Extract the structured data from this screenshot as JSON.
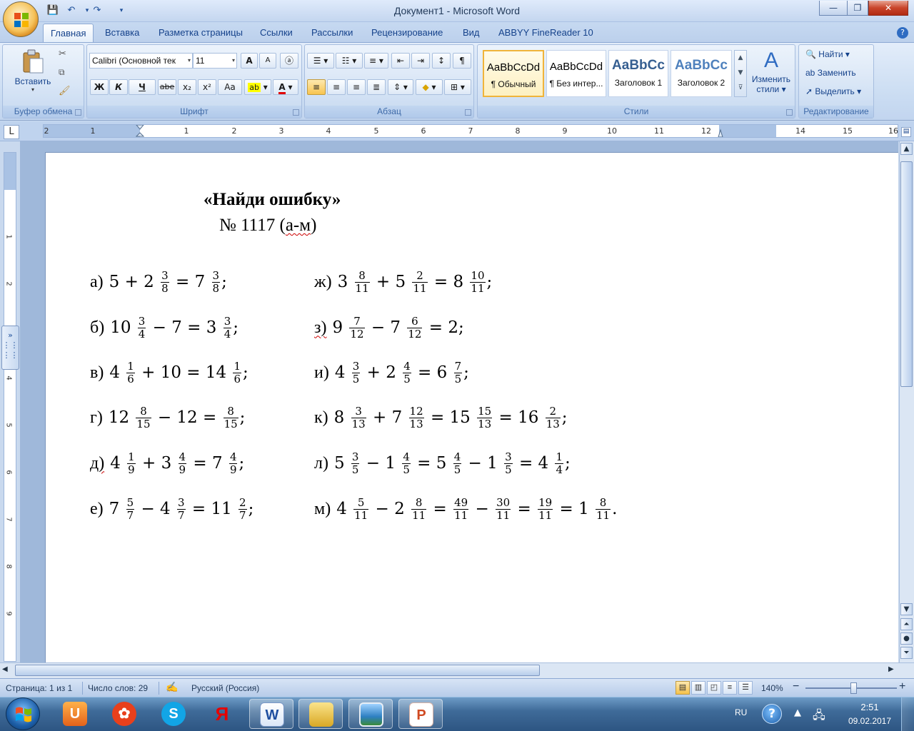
{
  "window": {
    "title": "Документ1 - Microsoft Word",
    "minimize": "—",
    "maximize": "❐",
    "close": "✕"
  },
  "qat": {
    "save": "💾",
    "undo": "↶",
    "redo": "↷",
    "customize": "▾"
  },
  "tabs": [
    "Главная",
    "Вставка",
    "Разметка страницы",
    "Ссылки",
    "Рассылки",
    "Рецензирование",
    "Вид",
    "ABBYY FineReader 10"
  ],
  "ribbon": {
    "clipboard": {
      "label": "Буфер обмена",
      "paste": "Вставить"
    },
    "font": {
      "label": "Шрифт",
      "font_name": "Calibri (Основной тек",
      "font_size": "11",
      "grow": "A",
      "shrink": "A",
      "clear": "ⓐ",
      "bold": "Ж",
      "italic": "К",
      "underline": "Ч",
      "strike": "abe",
      "subscript": "x₂",
      "superscript": "x²",
      "case": "Aa",
      "highlight": "ab",
      "font_color": "A"
    },
    "paragraph": {
      "label": "Абзац",
      "pilcrow": "¶"
    },
    "styles": {
      "label": "Стили",
      "items": [
        {
          "sample": "AaBbCcDd",
          "name": "¶ Обычный"
        },
        {
          "sample": "AaBbCcDd",
          "name": "¶ Без интер..."
        },
        {
          "sample": "AaBbCc",
          "name": "Заголовок 1"
        },
        {
          "sample": "AaBbCc",
          "name": "Заголовок 2"
        }
      ],
      "change_line1": "Изменить",
      "change_line2": "стили"
    },
    "editing": {
      "label": "Редактирование",
      "find": "Найти",
      "replace": "Заменить",
      "select": "Выделить"
    }
  },
  "ruler": {
    "corner": "L",
    "h_numbers": [
      "2",
      "1",
      "1",
      "1",
      "2",
      "3",
      "4",
      "5",
      "6",
      "7",
      "8",
      "9",
      "10",
      "11",
      "12",
      "14",
      "15",
      "16"
    ],
    "v_numbers": [
      "1",
      "1",
      "2",
      "3",
      "4",
      "5",
      "6",
      "7",
      "8",
      "9"
    ]
  },
  "document": {
    "heading": "«Найди ошибку»",
    "subheading_pre": "№ 1117 (",
    "subheading_marked": "а-м",
    "subheading_post": ")",
    "exercises": [
      {
        "label": "а)",
        "text": "5 + 2 3/8 = 7 3/8;"
      },
      {
        "label": "б)",
        "text": "10 3/4 − 7 = 3 3/4;"
      },
      {
        "label": "в)",
        "text": "4 1/6 + 10 = 14 1/6;"
      },
      {
        "label": "г)",
        "text": "12 8/15 − 12 = 8/15;"
      },
      {
        "label": "д)",
        "text": "4 1/9 + 3 4/9 = 7 4/9;"
      },
      {
        "label": "е)",
        "text": "7 5/7 − 4 3/7 = 11 2/7;"
      },
      {
        "label": "ж)",
        "text": "3 8/11 + 5 2/11 = 8 10/11;"
      },
      {
        "label": "з)",
        "text": "9 7/12 − 7 6/12 = 2;"
      },
      {
        "label": "и)",
        "text": "4 3/5 + 2 4/5 = 6 7/5;"
      },
      {
        "label": "к)",
        "text": "8 3/13 + 7 12/13 = 15 15/13 = 16 2/13;"
      },
      {
        "label": "л)",
        "text": "5 3/5 − 1 4/5 = 5 4/5 − 1 3/5 = 4 1/4;"
      },
      {
        "label": "м)",
        "text": "4 5/11 − 2 8/11 = 49/11 − 30/11 = 19/11 = 1 8/11."
      }
    ]
  },
  "statusbar": {
    "page": "Страница: 1 из 1",
    "words": "Число слов: 29",
    "language": "Русский (Россия)",
    "zoom": "140%",
    "zoom_out": "−",
    "zoom_in": "+"
  },
  "taskbar": {
    "apps": [
      "UC Browser",
      "Video player",
      "Skype",
      "Yandex",
      "Microsoft Word",
      "Explorer",
      "Photo viewer",
      "PowerPoint"
    ],
    "lang": "RU",
    "help": "?",
    "time": "2:51",
    "date": "09.02.2017"
  },
  "colors": {
    "ribbon": "#dbe8f8",
    "accent": "#15428b",
    "highlight": "#ffff00",
    "font_color": "#e00000"
  }
}
